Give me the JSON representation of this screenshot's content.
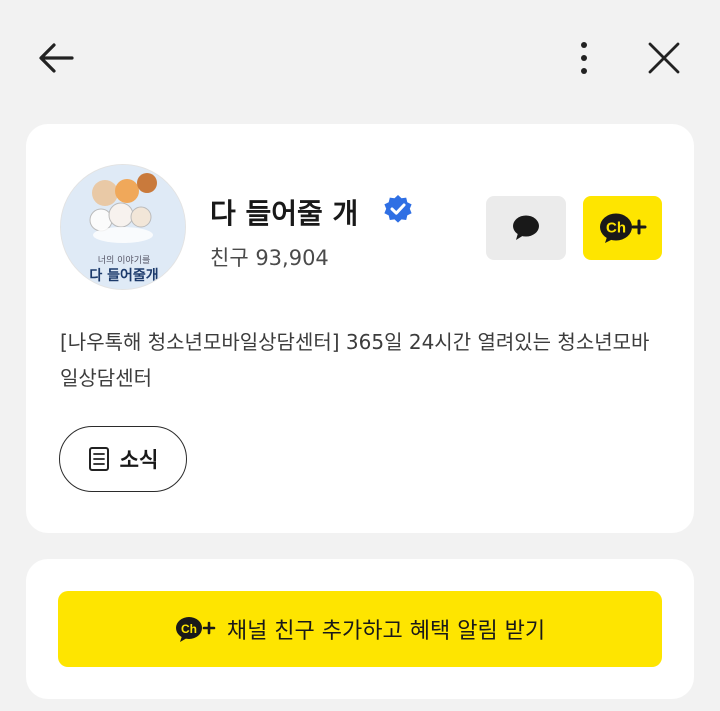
{
  "topbar": {
    "back_icon": "arrow-left-icon",
    "more_icon": "more-vertical-icon",
    "close_icon": "close-icon"
  },
  "profile": {
    "avatar": {
      "subtitle": "너의 이야기를",
      "title": "다 들어줄개"
    },
    "name": "다 들어줄 개",
    "verified_icon": "verified-badge-icon",
    "friends_count": "친구 93,904",
    "chat_button_icon": "chat-bubble-icon",
    "add_channel_icon": "channel-add-icon",
    "add_channel_label": "Ch",
    "description": "[나우톡해 청소년모바일상담센터] 365일 24시간 열려있는 청소년모바일상담센터",
    "news_button": {
      "icon": "document-icon",
      "label": "소식"
    }
  },
  "cta": {
    "icon_label": "Ch",
    "label": "채널 친구 추가하고 혜택 알림 받기"
  },
  "colors": {
    "background": "#f2f2f2",
    "card": "#ffffff",
    "kakao_yellow": "#fee500",
    "verified_blue": "#2f6fe4",
    "chat_button_bg": "#ebebeb"
  }
}
